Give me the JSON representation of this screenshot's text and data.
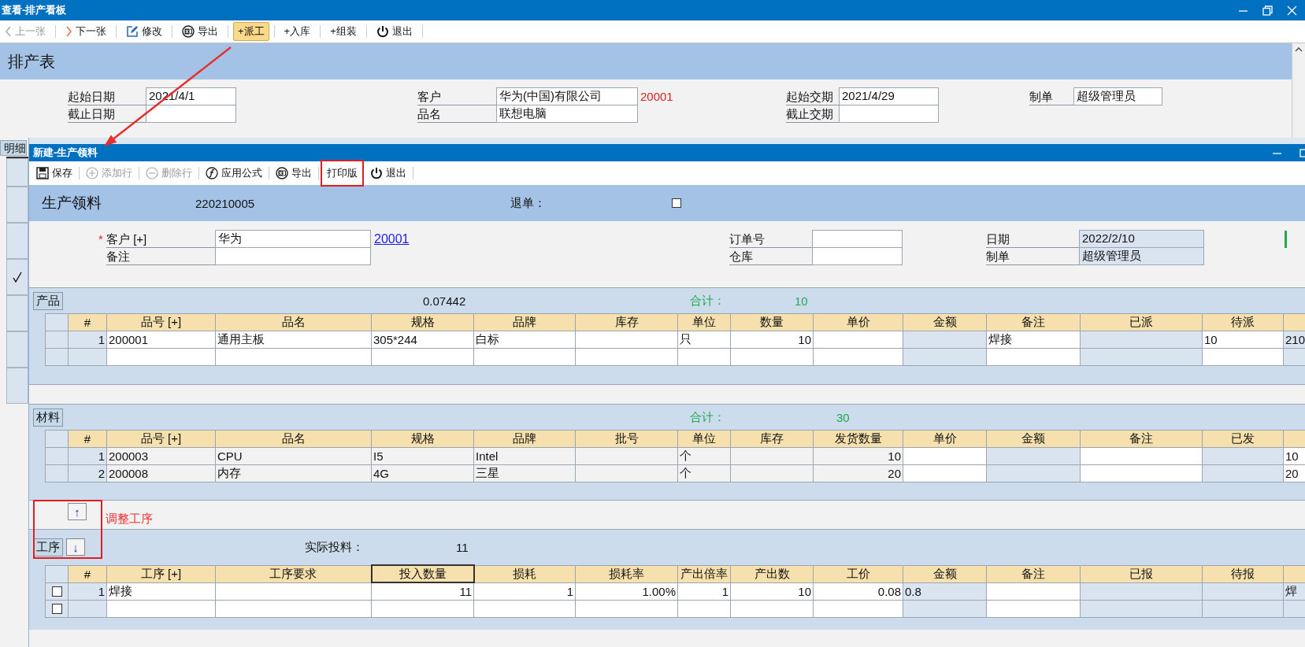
{
  "window": {
    "title": "查看-排产看板"
  },
  "toolbar": [
    {
      "label": "上一张",
      "kind": "prev",
      "disabled": true,
      "highlighted": false
    },
    {
      "label": "下一张",
      "kind": "next",
      "disabled": false,
      "highlighted": false
    },
    {
      "label": "修改",
      "kind": "edit",
      "disabled": false,
      "highlighted": false
    },
    {
      "label": "导出",
      "kind": "export",
      "disabled": false,
      "highlighted": false
    },
    {
      "label": "+派工",
      "kind": "text",
      "disabled": false,
      "highlighted": true
    },
    {
      "label": "+入库",
      "kind": "text",
      "disabled": false,
      "highlighted": false
    },
    {
      "label": "+组装",
      "kind": "text",
      "disabled": false,
      "highlighted": false
    },
    {
      "label": "退出",
      "kind": "exit",
      "disabled": false,
      "highlighted": false
    }
  ],
  "schedule": {
    "title": "排产表",
    "field_groups": [
      [
        {
          "label": "起始日期",
          "value": "2021/4/1"
        },
        {
          "label": "截止日期"
        }
      ],
      [
        {
          "label": "客户",
          "value": "华为(中国)有限公司",
          "code": "20001"
        },
        {
          "label": "品名",
          "value": "联想电脑"
        }
      ],
      [
        {
          "label": "起始交期",
          "value": "2021/4/29"
        },
        {
          "label": "截止交期"
        }
      ],
      [
        {
          "label": "制单",
          "value": "超级管理员"
        }
      ]
    ]
  },
  "background_list": {
    "tab": "明细",
    "rows": [
      {
        "checked": false
      },
      {
        "checked": false
      },
      {
        "checked": false
      },
      {
        "checked": true
      },
      {
        "checked": false
      },
      {
        "checked": false
      },
      {
        "checked": false
      }
    ]
  },
  "dialog": {
    "title": "新建-生产领料",
    "toolbar": [
      {
        "label": "保存",
        "kind": "save",
        "disabled": false,
        "annotated": false
      },
      {
        "label": "添加行",
        "kind": "add",
        "disabled": true,
        "annotated": false
      },
      {
        "label": "删除行",
        "kind": "remove",
        "disabled": true,
        "annotated": false
      },
      {
        "label": "应用公式",
        "kind": "formula",
        "disabled": false,
        "annotated": false
      },
      {
        "label": "导出",
        "kind": "export",
        "disabled": false,
        "annotated": false
      },
      {
        "label": "打印版",
        "kind": "text",
        "disabled": false,
        "annotated": true
      },
      {
        "label": "退出",
        "kind": "exit",
        "disabled": false,
        "annotated": false
      }
    ],
    "header": {
      "title": "生产领料",
      "number": "220210005",
      "return_label": "退单：",
      "return_checked": false
    },
    "field_groups": [
      [
        {
          "label": "客户 [+]",
          "marker": "*",
          "value": "华为",
          "link": "20001",
          "readonly": false
        },
        {
          "label": "备注",
          "readonly": false
        }
      ],
      [
        {
          "label": "订单号",
          "readonly": false
        },
        {
          "label": "仓库",
          "readonly": false
        }
      ],
      [
        {
          "label": "日期",
          "value": "2022/2/10",
          "readonly": true
        },
        {
          "label": "制单",
          "value": "超级管理员",
          "readonly": true
        }
      ]
    ],
    "sections": [
      {
        "kind": "products",
        "tab": "产品",
        "ratio": "0.07442",
        "total_label": "合计：",
        "total": "10",
        "columns": [
          {
            "label": "#",
            "kind": "index"
          },
          {
            "label": "品号 [+]",
            "kind": "edit"
          },
          {
            "label": "品名",
            "kind": "edit"
          },
          {
            "label": "规格",
            "kind": "edit"
          },
          {
            "label": "品牌",
            "kind": "edit"
          },
          {
            "label": "库存",
            "kind": "edit"
          },
          {
            "label": "单位",
            "kind": "edit"
          },
          {
            "label": "数量",
            "kind": "edit",
            "numeric": true
          },
          {
            "label": "单价",
            "kind": "edit"
          },
          {
            "label": "金额",
            "kind": "calc"
          },
          {
            "label": "备注",
            "kind": "edit"
          },
          {
            "label": "已派",
            "kind": "calc"
          },
          {
            "label": "待派",
            "kind": "edit"
          },
          {
            "kind": "calc"
          }
        ],
        "rows": [
          {
            "cells": [
              "1",
              "200001",
              "通用主板",
              "305*244",
              "白标",
              null,
              "只",
              "10",
              null,
              null,
              "焊接",
              null,
              "10",
              "210"
            ]
          },
          {
            "cells": []
          }
        ]
      },
      {
        "kind": "materials",
        "tab": "材料",
        "total_label": "合计：",
        "total": "30",
        "columns": [
          {
            "label": "#",
            "kind": "index"
          },
          {
            "label": "品号 [+]",
            "kind": "fixed"
          },
          {
            "label": "品名",
            "kind": "fixed"
          },
          {
            "label": "规格",
            "kind": "fixed"
          },
          {
            "label": "品牌",
            "kind": "fixed"
          },
          {
            "label": "批号",
            "kind": "fixed"
          },
          {
            "label": "单位",
            "kind": "fixed"
          },
          {
            "label": "库存",
            "kind": "fixed"
          },
          {
            "label": "发货数量",
            "kind": "fixed",
            "numeric": true
          },
          {
            "label": "单价",
            "kind": "edit"
          },
          {
            "label": "金额",
            "kind": "calc"
          },
          {
            "label": "备注",
            "kind": "edit"
          },
          {
            "label": "已发",
            "kind": "calc"
          },
          {
            "kind": "edit"
          }
        ],
        "rows": [
          {
            "cells": [
              "1",
              "200003",
              "CPU",
              "I5",
              "Intel",
              null,
              "个",
              null,
              "10",
              null,
              null,
              null,
              null,
              "10"
            ]
          },
          {
            "cells": [
              "2",
              "200008",
              "内存",
              "4G",
              "三星",
              null,
              "个",
              null,
              "20",
              null,
              null,
              null,
              null,
              "20"
            ]
          }
        ]
      },
      {
        "kind": "process",
        "tab": "工序",
        "actual_label": "实际投料：",
        "actual": "11",
        "order_controls": {
          "up": "↑",
          "down": "↓",
          "note": "调整工序",
          "annotated": true
        },
        "columns": [
          {
            "label": "#",
            "kind": "index",
            "selected": false
          },
          {
            "label": "工序 [+]",
            "kind": "edit",
            "selected": false
          },
          {
            "label": "工序要求",
            "kind": "edit",
            "selected": false
          },
          {
            "label": "投入数量",
            "kind": "edit",
            "numeric": true,
            "selected": true
          },
          {
            "label": "损耗",
            "kind": "edit",
            "numeric": true,
            "selected": false
          },
          {
            "label": "损耗率",
            "kind": "edit",
            "numeric": true,
            "selected": false
          },
          {
            "label": "产出倍率",
            "kind": "edit",
            "numeric": true,
            "selected": false
          },
          {
            "label": "产出数",
            "kind": "edit",
            "numeric": true,
            "selected": false
          },
          {
            "label": "工价",
            "kind": "edit",
            "numeric": true,
            "selected": false
          },
          {
            "label": "金额",
            "kind": "calc",
            "selected": false
          },
          {
            "label": "备注",
            "kind": "edit",
            "selected": false
          },
          {
            "label": "已报",
            "kind": "calc",
            "selected": false
          },
          {
            "label": "待报",
            "kind": "calc",
            "selected": false
          },
          {
            "kind": "calc",
            "selected": false
          }
        ],
        "rows": [
          {
            "checked": false,
            "cells": [
              "1",
              "焊接",
              null,
              "11",
              "1",
              "1.00%",
              "1",
              "10",
              "0.08",
              "0.8",
              null,
              null,
              null,
              "焊"
            ]
          },
          {
            "checked": false,
            "cells": []
          }
        ]
      }
    ]
  }
}
